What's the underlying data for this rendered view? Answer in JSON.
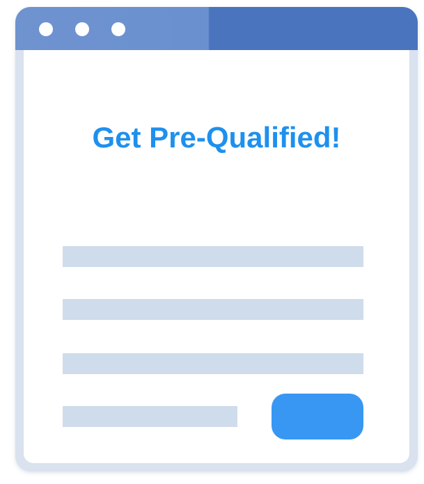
{
  "window": {
    "titlebar_colors": {
      "left": "#6f93cf",
      "right": "#4a74be"
    },
    "dots": [
      "window-dot",
      "window-dot",
      "window-dot"
    ]
  },
  "form": {
    "heading": "Get Pre-Qualified!",
    "heading_color": "#1e90ee",
    "field_placeholder_color": "#cfdceb",
    "button_color": "#3797f3",
    "button_label": ""
  }
}
